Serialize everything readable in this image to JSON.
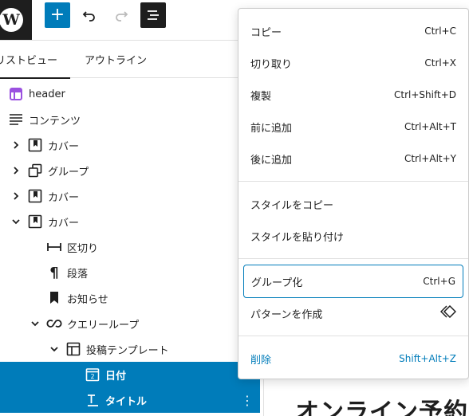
{
  "tabs": {
    "list_view": "リストビュー",
    "outline": "アウトライン"
  },
  "tree": [
    {
      "label": "header",
      "icon": "template-part-icon",
      "chevron": ""
    },
    {
      "label": "コンテンツ",
      "icon": "post-content-icon",
      "chevron": ""
    },
    {
      "label": "カバー",
      "icon": "cover-icon",
      "chevron": "right"
    },
    {
      "label": "グループ",
      "icon": "group-icon",
      "chevron": "right"
    },
    {
      "label": "カバー",
      "icon": "cover-icon",
      "chevron": "right"
    },
    {
      "label": "カバー",
      "icon": "cover-icon",
      "chevron": "down"
    },
    {
      "label": "区切り",
      "icon": "separator-icon",
      "chevron": ""
    },
    {
      "label": "段落",
      "icon": "paragraph-icon",
      "chevron": ""
    },
    {
      "label": "お知らせ",
      "icon": "bookmark-icon",
      "chevron": ""
    },
    {
      "label": "クエリーループ",
      "icon": "loop-icon",
      "chevron": "down"
    },
    {
      "label": "投稿テンプレート",
      "icon": "layout-icon",
      "chevron": "down"
    },
    {
      "label": "日付",
      "icon": "date-icon",
      "chevron": ""
    },
    {
      "label": "タイトル",
      "icon": "title-icon",
      "chevron": ""
    }
  ],
  "menu": {
    "copy": {
      "label": "コピー",
      "shortcut": "Ctrl+C"
    },
    "cut": {
      "label": "切り取り",
      "shortcut": "Ctrl+X"
    },
    "duplicate": {
      "label": "複製",
      "shortcut": "Ctrl+Shift+D"
    },
    "insert_before": {
      "label": "前に追加",
      "shortcut": "Ctrl+Alt+T"
    },
    "insert_after": {
      "label": "後に追加",
      "shortcut": "Ctrl+Alt+Y"
    },
    "copy_styles": {
      "label": "スタイルをコピー"
    },
    "paste_styles": {
      "label": "スタイルを貼り付け"
    },
    "group": {
      "label": "グループ化",
      "shortcut": "Ctrl+G"
    },
    "create_pattern": {
      "label": "パターンを作成"
    },
    "delete": {
      "label": "削除",
      "shortcut": "Shift+Alt+Z"
    }
  },
  "editor": {
    "heading_partial": "オンライン予約"
  },
  "colors": {
    "accent": "#007cba",
    "dark": "#1e1e1e",
    "template_part": "#9b51e0"
  }
}
